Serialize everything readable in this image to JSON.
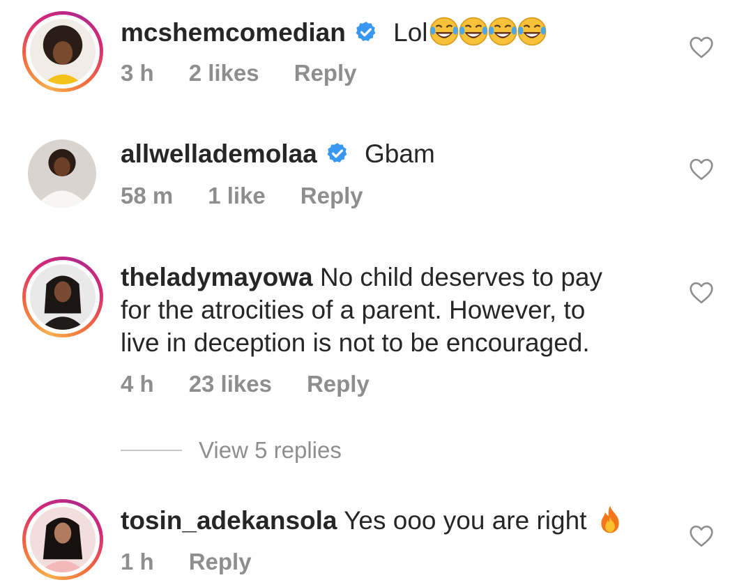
{
  "comments": [
    {
      "username": "mcshemcomedian",
      "verified": true,
      "text": "Lol",
      "emoji": [
        "face-with-tears-of-joy",
        "face-with-tears-of-joy",
        "face-with-tears-of-joy",
        "face-with-tears-of-joy"
      ],
      "time": "3 h",
      "likes": "2 likes",
      "reply": "Reply",
      "story_ring": true
    },
    {
      "username": "allwellademolaa",
      "verified": true,
      "text": "Gbam",
      "time": "58 m",
      "likes": "1 like",
      "reply": "Reply",
      "story_ring": false
    },
    {
      "username": "theladymayowa",
      "verified": false,
      "text_lines": [
        " No child deserves to pay",
        "for the atrocities of a parent. However, to",
        "live in deception is not to be encouraged."
      ],
      "time": "4 h",
      "likes": "23 likes",
      "reply": "Reply",
      "story_ring": true,
      "view_replies": "View 5 replies"
    },
    {
      "username": "tosin_adekansola",
      "verified": false,
      "text": " Yes ooo you are right ",
      "emoji": [
        "fire"
      ],
      "time": "1 h",
      "reply": "Reply",
      "story_ring": true
    }
  ],
  "icons": {
    "like": "heart-outline-icon",
    "verified": "verified-badge-icon"
  },
  "colors": {
    "text": "#262626",
    "meta": "#8e8e8e",
    "verified": "#3897f0",
    "ring_start": "#f8b04a",
    "ring_end": "#d62976"
  }
}
